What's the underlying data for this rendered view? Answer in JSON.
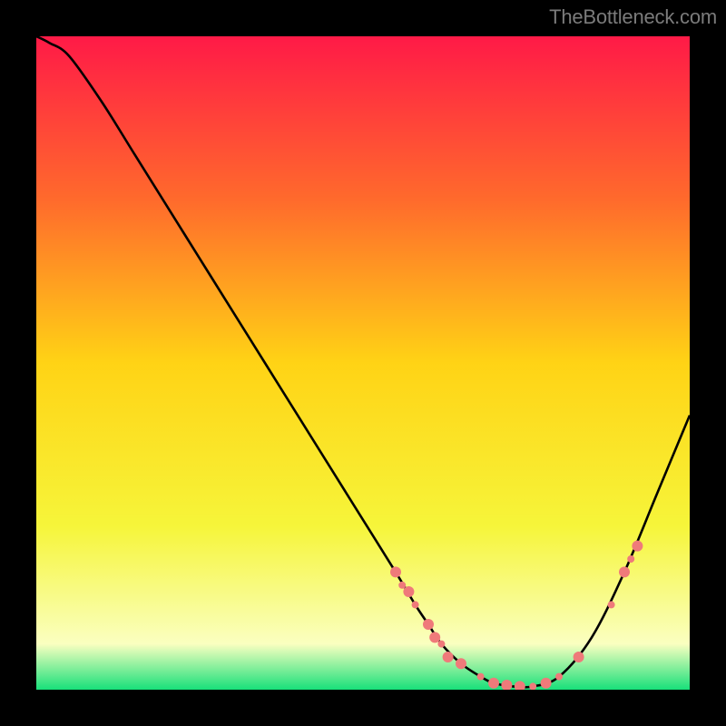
{
  "attribution": "TheBottleneck.com",
  "chart_data": {
    "type": "line",
    "title": "",
    "xlabel": "",
    "ylabel": "",
    "xlim": [
      0,
      100
    ],
    "ylim": [
      0,
      100
    ],
    "grid": false,
    "legend": false,
    "background_gradient_stops": [
      {
        "offset": 0,
        "color": "#ff1a47"
      },
      {
        "offset": 0.25,
        "color": "#ff6a2c"
      },
      {
        "offset": 0.5,
        "color": "#ffd315"
      },
      {
        "offset": 0.75,
        "color": "#f6f53a"
      },
      {
        "offset": 0.93,
        "color": "#faffc0"
      },
      {
        "offset": 1.0,
        "color": "#18e07a"
      }
    ],
    "series": [
      {
        "name": "bottleneck-curve",
        "color": "#000000",
        "x": [
          0,
          2,
          5,
          10,
          15,
          20,
          25,
          30,
          35,
          40,
          45,
          50,
          55,
          58,
          60,
          62,
          65,
          68,
          70,
          73,
          76,
          80,
          85,
          90,
          95,
          100
        ],
        "y": [
          100,
          99,
          97,
          90,
          82,
          74,
          66,
          58,
          50,
          42,
          34,
          26,
          18,
          13,
          10,
          7,
          4,
          2,
          1,
          0.5,
          0.5,
          2,
          8,
          18,
          30,
          42
        ]
      }
    ],
    "markers": {
      "name": "highlight-points",
      "color": "#ef7a7a",
      "radius_small": 4,
      "radius_large": 6,
      "points": [
        {
          "x": 55,
          "y": 18,
          "r": "large"
        },
        {
          "x": 56,
          "y": 16,
          "r": "small"
        },
        {
          "x": 57,
          "y": 15,
          "r": "large"
        },
        {
          "x": 58,
          "y": 13,
          "r": "small"
        },
        {
          "x": 60,
          "y": 10,
          "r": "large"
        },
        {
          "x": 61,
          "y": 8,
          "r": "large"
        },
        {
          "x": 62,
          "y": 7,
          "r": "small"
        },
        {
          "x": 63,
          "y": 5,
          "r": "large"
        },
        {
          "x": 65,
          "y": 4,
          "r": "large"
        },
        {
          "x": 68,
          "y": 2,
          "r": "small"
        },
        {
          "x": 70,
          "y": 1,
          "r": "large"
        },
        {
          "x": 72,
          "y": 0.7,
          "r": "large"
        },
        {
          "x": 74,
          "y": 0.5,
          "r": "large"
        },
        {
          "x": 76,
          "y": 0.5,
          "r": "small"
        },
        {
          "x": 78,
          "y": 1,
          "r": "large"
        },
        {
          "x": 80,
          "y": 2,
          "r": "small"
        },
        {
          "x": 83,
          "y": 5,
          "r": "large"
        },
        {
          "x": 88,
          "y": 13,
          "r": "small"
        },
        {
          "x": 90,
          "y": 18,
          "r": "large"
        },
        {
          "x": 91,
          "y": 20,
          "r": "small"
        },
        {
          "x": 92,
          "y": 22,
          "r": "large"
        }
      ]
    }
  }
}
